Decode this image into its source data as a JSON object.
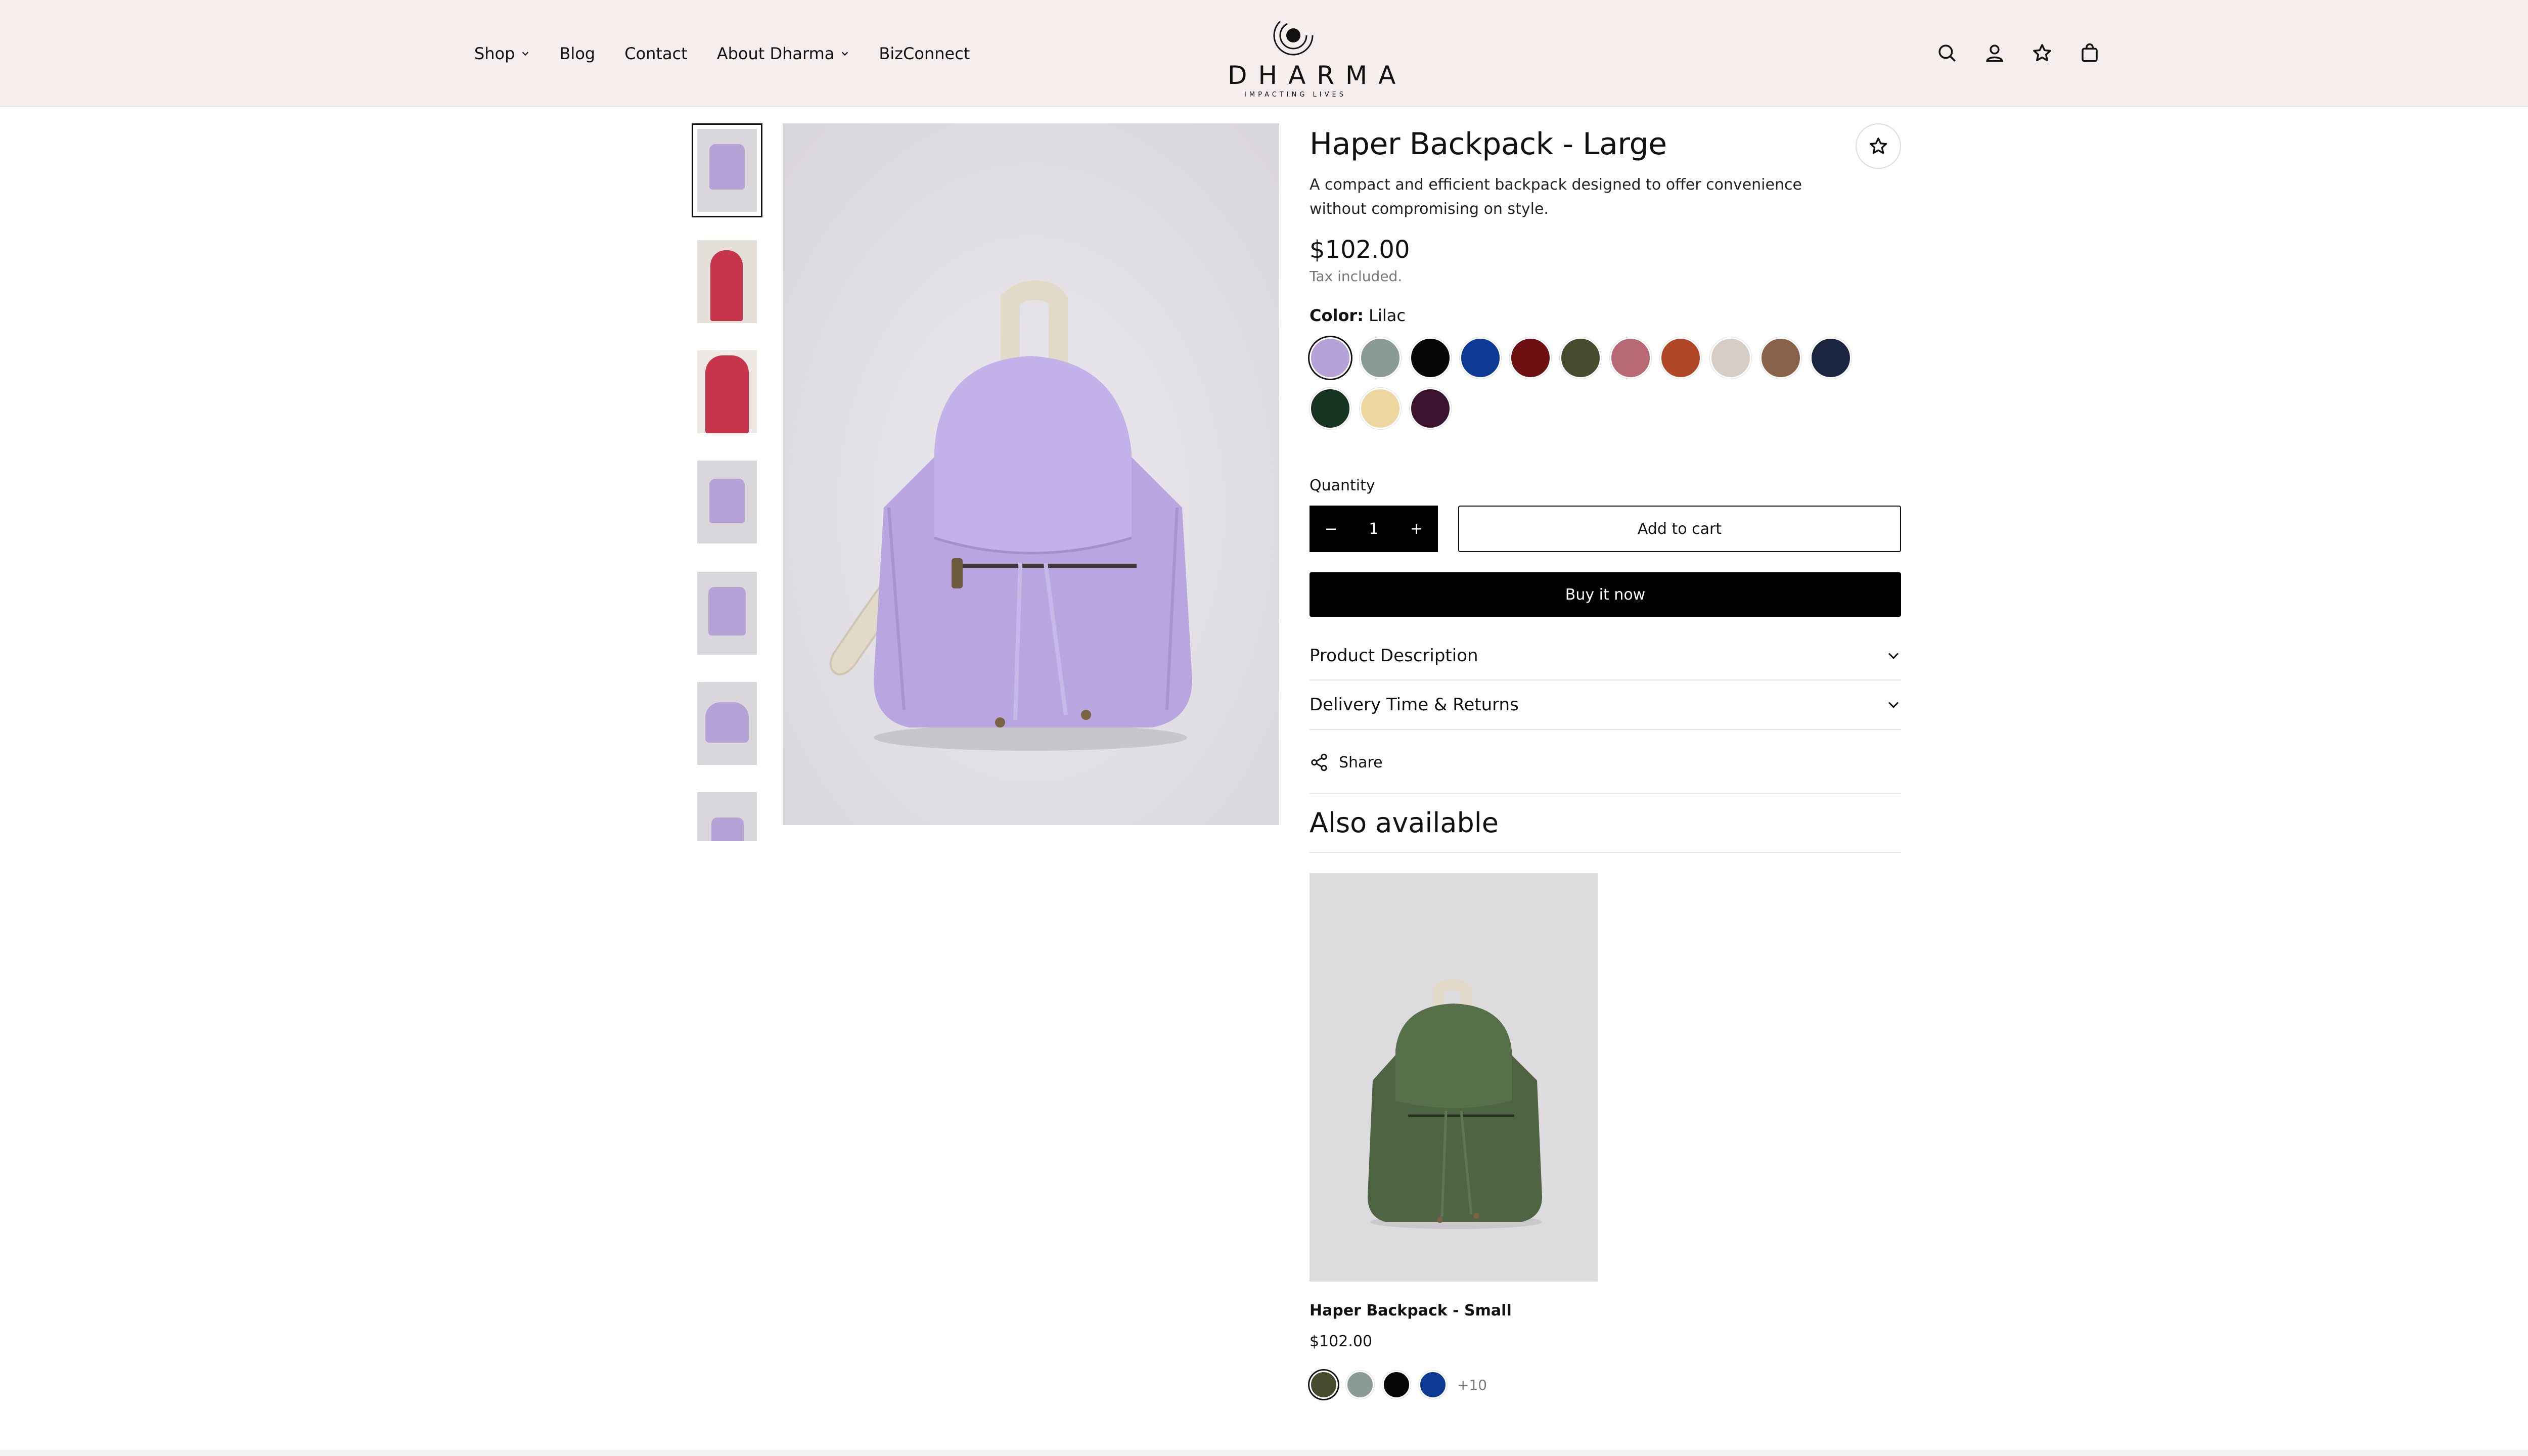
{
  "nav": {
    "items": [
      {
        "label": "Shop",
        "dropdown": true
      },
      {
        "label": "Blog",
        "dropdown": false
      },
      {
        "label": "Contact",
        "dropdown": false
      },
      {
        "label": "About Dharma",
        "dropdown": true
      },
      {
        "label": "BizConnect",
        "dropdown": false
      }
    ],
    "logo_text": "DHARMA",
    "logo_tagline": "IMPACTING LIVES",
    "icons": [
      "search-icon",
      "account-icon",
      "wishlist-star-icon",
      "cart-bag-icon"
    ]
  },
  "product": {
    "title": "Haper Backpack - Large",
    "description": "A compact and efficient backpack designed to offer convenience without compromising on style.",
    "price": "$102.00",
    "tax_note": "Tax included.",
    "color_label": "Color:",
    "color_value": "Lilac",
    "colors": [
      "#b7a2d8",
      "#8a9a96",
      "#060606",
      "#0d3b94",
      "#6e0f12",
      "#464d2f",
      "#b86a74",
      "#b24727",
      "#d6cec5",
      "#8a6149",
      "#1b2540",
      "#173321",
      "#ecd79f",
      "#3c1430"
    ],
    "quantity_label": "Quantity",
    "quantity": "1",
    "add_to_cart": "Add to cart",
    "buy_now": "Buy it now",
    "accordion": [
      "Product Description",
      "Delivery Time & Returns"
    ],
    "share": "Share"
  },
  "gallery": {
    "thumb_count": 7,
    "thumb_tones": [
      "#cfc7e0",
      "#e7dbd6",
      "#c7354d",
      "#cfc7e0",
      "#cfc7e0",
      "#cfc7e0",
      "#cfc7e0"
    ]
  },
  "also": {
    "heading": "Also available",
    "card": {
      "name": "Haper Backpack - Small",
      "price": "$102.00",
      "swatches": [
        "#464d2f",
        "#8a9a96",
        "#060606",
        "#0d3b94"
      ],
      "more": "+10"
    }
  }
}
